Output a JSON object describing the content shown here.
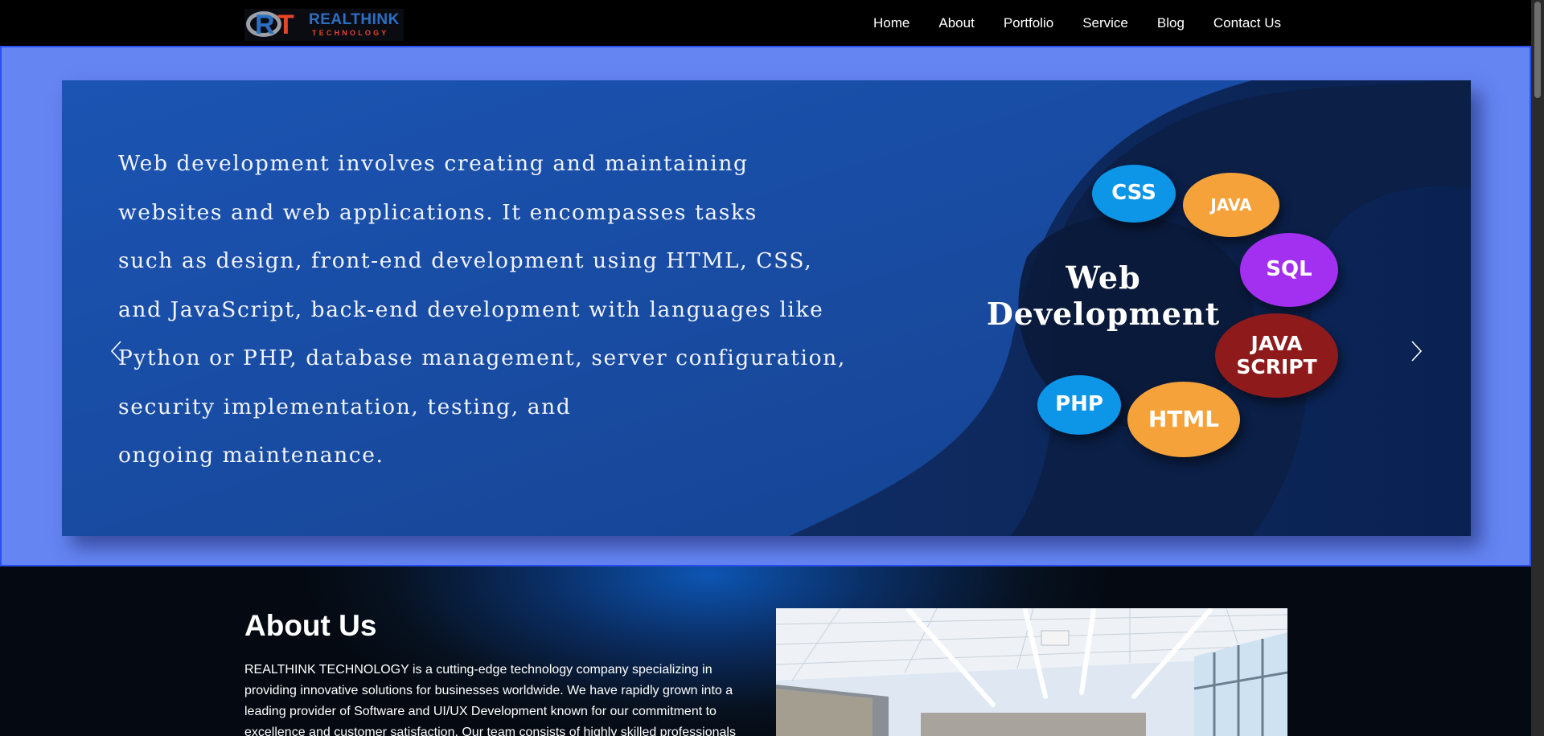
{
  "brand": {
    "logo_mark_r": "R",
    "logo_mark_t": "T",
    "name": "REALTHINK",
    "sub": "TECHNOLOGY"
  },
  "nav": {
    "items": [
      {
        "label": "Home"
      },
      {
        "label": "About"
      },
      {
        "label": "Portfolio"
      },
      {
        "label": "Service"
      },
      {
        "label": "Blog"
      },
      {
        "label": "Contact Us"
      }
    ]
  },
  "hero": {
    "text": "Web development involves creating and maintaining\n websites and web applications. It encompasses tasks\nsuch as design, front-end development using HTML, CSS,\nand JavaScript, back-end development with languages like\n Python or PHP, database management, server configuration,\nsecurity implementation, testing, and\nongoing maintenance.",
    "graphic_title": "Web\nDevelopment",
    "bubbles": [
      {
        "label": "CSS",
        "color": "#0d95e8"
      },
      {
        "label": "JAVA",
        "color": "#f5a23a"
      },
      {
        "label": "SQL",
        "color": "#a32ff0"
      },
      {
        "label": "JAVA\nSCRIPT",
        "color": "#8e1a1c"
      },
      {
        "label": "PHP",
        "color": "#0d95e8"
      },
      {
        "label": "HTML",
        "color": "#f5a23a"
      }
    ],
    "indicators": {
      "count": 3,
      "active_index": 1
    },
    "prev_icon": "chevron-left-icon",
    "next_icon": "chevron-right-icon"
  },
  "about": {
    "title": "About Us",
    "text": "REALTHINK TECHNOLOGY is a cutting-edge technology company specializing in providing innovative solutions for businesses worldwide. We have rapidly grown into a leading provider of Software and UI/UX Development known for our commitment to excellence and customer satisfaction. Our team consists of highly skilled professionals"
  },
  "colors": {
    "hero_frame": "#6585f3",
    "slide_bg": "#1a4fa8",
    "navbar_bg": "#000000"
  }
}
